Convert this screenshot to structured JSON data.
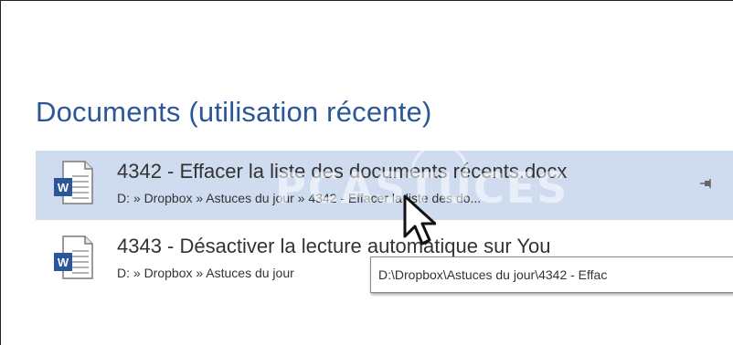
{
  "recent_documents": {
    "title": "Documents (utilisation récente)",
    "items": [
      {
        "name": "4342 - Effacer la liste des documents récents.docx",
        "path": "D: » Dropbox » Astuces du jour » 4342 - Effacer la liste des do...",
        "selected": true,
        "icon": "word-document-icon"
      },
      {
        "name": "4343 - Désactiver la lecture automatique sur You",
        "path": "D: » Dropbox » Astuces du jour",
        "selected": false,
        "icon": "word-document-icon"
      }
    ]
  },
  "tooltip": {
    "text": "D:\\Dropbox\\Astuces du jour\\4342 - Effac"
  },
  "watermark": {
    "text": "PCASTUCES"
  },
  "colors": {
    "title": "#2b579a",
    "selected_row": "#cfdcef",
    "word_blue": "#2b579a"
  }
}
